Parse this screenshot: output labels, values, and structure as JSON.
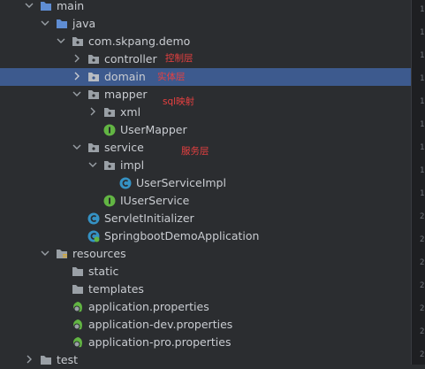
{
  "tree": {
    "main": "main",
    "java": "java",
    "package": "com.skpang.demo",
    "controller": "controller",
    "domain": "domain",
    "mapper": "mapper",
    "xml": "xml",
    "user_mapper": "UserMapper",
    "service": "service",
    "impl": "impl",
    "user_service_impl": "UserServiceImpl",
    "iuser_service": "IUserService",
    "servlet_initializer": "ServletInitializer",
    "app_class": "SpringbootDemoApplication",
    "resources": "resources",
    "static": "static",
    "templates": "templates",
    "app_props": "application.properties",
    "app_dev_props": "application-dev.properties",
    "app_pro_props": "application-pro.properties",
    "test": "test"
  },
  "annotations": {
    "controller": "控制层",
    "domain": "实体层",
    "mapper": "sql映射",
    "service": "服务层"
  },
  "colors": {
    "background": "#2b2d30",
    "selected_row": "#3d5a8e",
    "annotation": "#e74040",
    "class_icon": "#3592c4",
    "interface_icon": "#62b543",
    "folder_icon": "#9aa0a6",
    "resources_stripe": "#d4a93a"
  }
}
